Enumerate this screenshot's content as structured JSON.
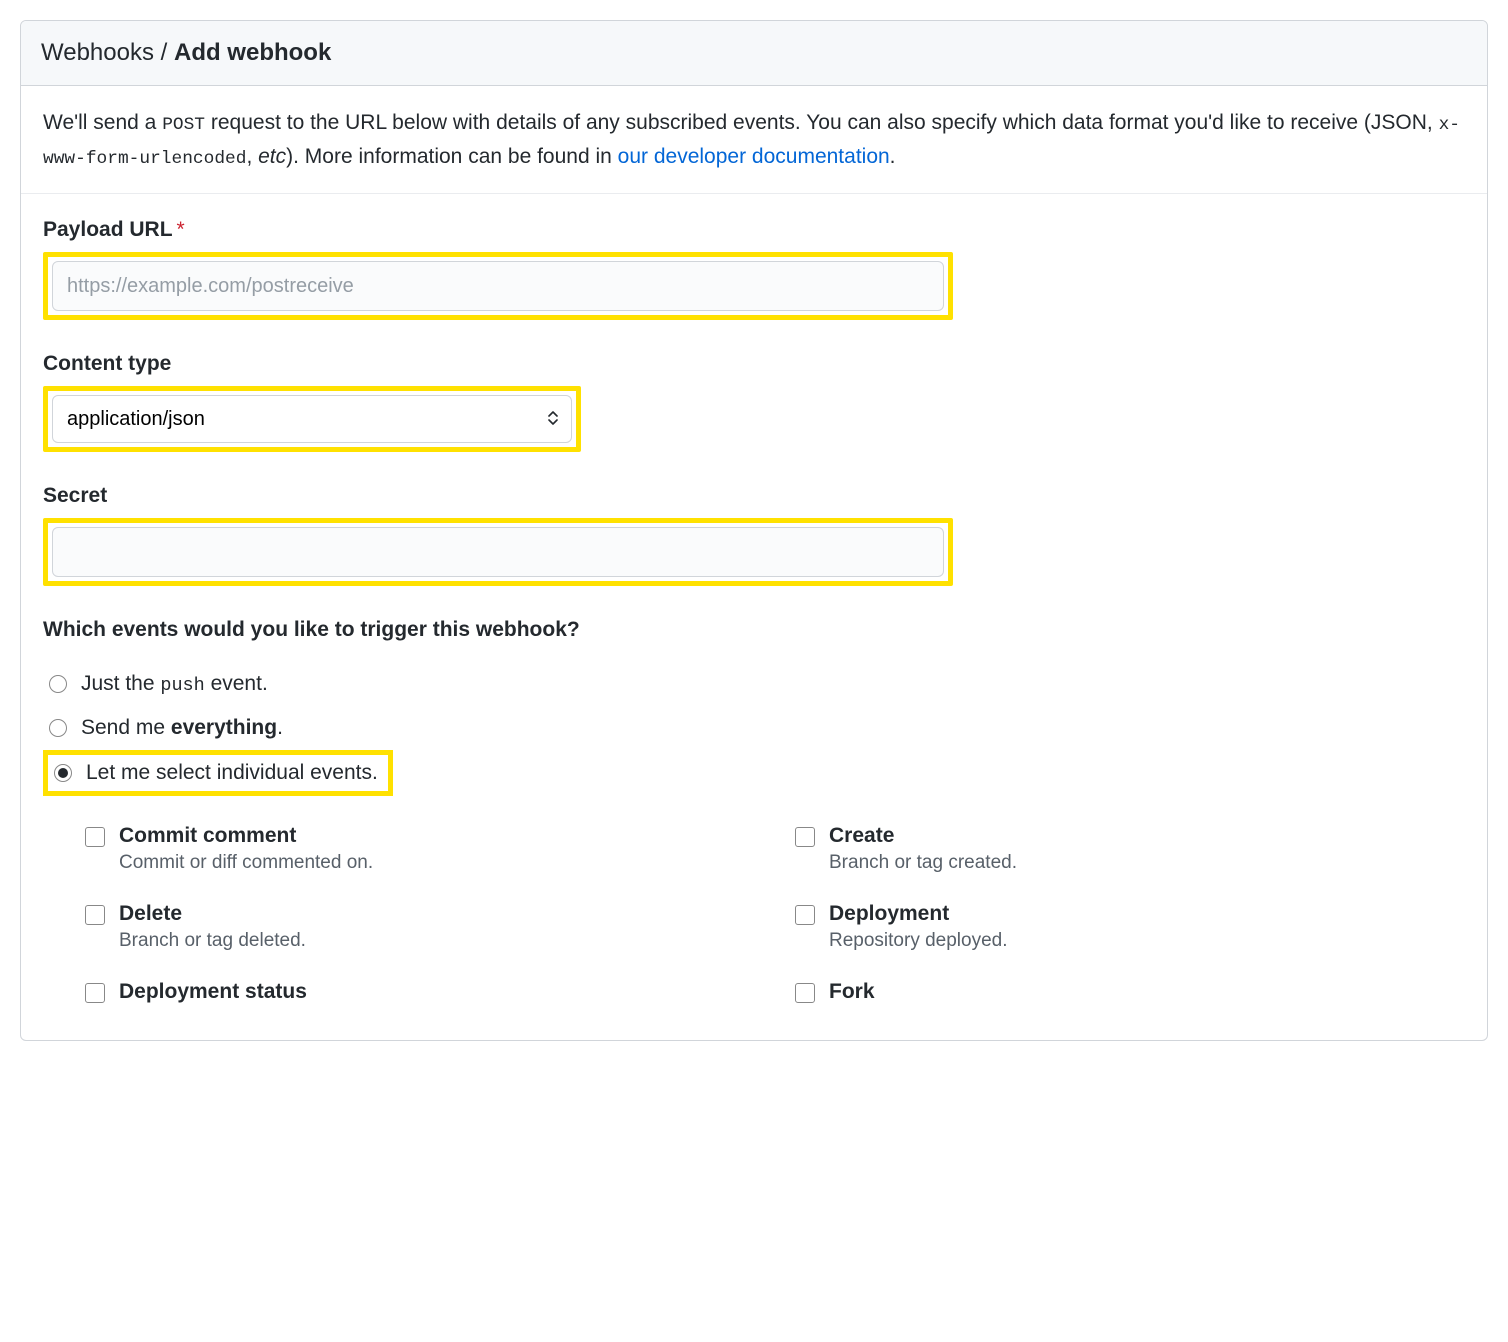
{
  "breadcrumb": {
    "parent": "Webhooks",
    "separator": " / ",
    "current": "Add webhook"
  },
  "description": {
    "pre": "We'll send a ",
    "post_code": "POST",
    "mid1": " request to the URL below with details of any subscribed events. You can also specify which data format you'd like to receive (JSON, ",
    "enc_code": "x-www-form-urlencoded",
    "mid2": ", ",
    "etc": "etc",
    "mid3": "). More information can be found in ",
    "link": "our developer documentation",
    "end": "."
  },
  "form": {
    "payload_url": {
      "label": "Payload URL",
      "required_mark": "*",
      "placeholder": "https://example.com/postreceive",
      "value": ""
    },
    "content_type": {
      "label": "Content type",
      "selected": "application/json"
    },
    "secret": {
      "label": "Secret",
      "value": ""
    },
    "events_question": "Which events would you like to trigger this webhook?",
    "radio_options": {
      "just_push": {
        "pre": "Just the ",
        "code": "push",
        "post": " event."
      },
      "everything": {
        "pre": "Send me ",
        "bold": "everything",
        "post": "."
      },
      "individual": "Let me select individual events."
    },
    "selected_radio": "individual",
    "events": [
      {
        "title": "Commit comment",
        "desc": "Commit or diff commented on."
      },
      {
        "title": "Create",
        "desc": "Branch or tag created."
      },
      {
        "title": "Delete",
        "desc": "Branch or tag deleted."
      },
      {
        "title": "Deployment",
        "desc": "Repository deployed."
      },
      {
        "title": "Deployment status",
        "desc": ""
      },
      {
        "title": "Fork",
        "desc": ""
      }
    ]
  }
}
